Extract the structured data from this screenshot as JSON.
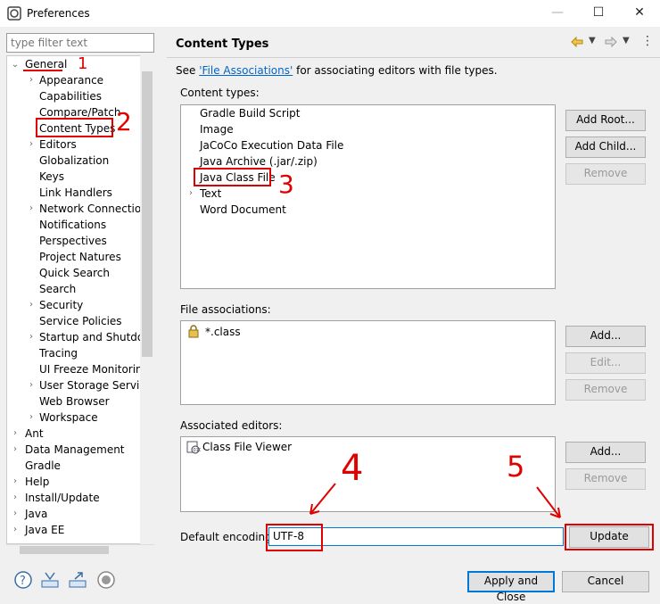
{
  "window": {
    "title": "Preferences",
    "minimize": "—",
    "maximize": "☐",
    "close": "✕"
  },
  "filter": {
    "placeholder": "type filter text"
  },
  "tree": {
    "general": "General",
    "general_children": [
      {
        "label": "Appearance",
        "expandable": true
      },
      {
        "label": "Capabilities",
        "expandable": false
      },
      {
        "label": "Compare/Patch",
        "expandable": false
      },
      {
        "label": "Content Types",
        "expandable": false
      },
      {
        "label": "Editors",
        "expandable": true
      },
      {
        "label": "Globalization",
        "expandable": false
      },
      {
        "label": "Keys",
        "expandable": false
      },
      {
        "label": "Link Handlers",
        "expandable": false
      },
      {
        "label": "Network Connection",
        "expandable": true
      },
      {
        "label": "Notifications",
        "expandable": false
      },
      {
        "label": "Perspectives",
        "expandable": false
      },
      {
        "label": "Project Natures",
        "expandable": false
      },
      {
        "label": "Quick Search",
        "expandable": false
      },
      {
        "label": "Search",
        "expandable": false
      },
      {
        "label": "Security",
        "expandable": true
      },
      {
        "label": "Service Policies",
        "expandable": false
      },
      {
        "label": "Startup and Shutdow",
        "expandable": true
      },
      {
        "label": "Tracing",
        "expandable": false
      },
      {
        "label": "UI Freeze Monitoring",
        "expandable": false
      },
      {
        "label": "User Storage Service",
        "expandable": true
      },
      {
        "label": "Web Browser",
        "expandable": false
      },
      {
        "label": "Workspace",
        "expandable": true
      }
    ],
    "top_level": [
      {
        "label": "Ant",
        "expandable": true
      },
      {
        "label": "Data Management",
        "expandable": true
      },
      {
        "label": "Gradle",
        "expandable": false
      },
      {
        "label": "Help",
        "expandable": true
      },
      {
        "label": "Install/Update",
        "expandable": true
      },
      {
        "label": "Java",
        "expandable": true
      },
      {
        "label": "Java EE",
        "expandable": true
      }
    ]
  },
  "page": {
    "title": "Content Types",
    "intro_before": "See ",
    "intro_link": "'File Associations'",
    "intro_after": " for associating editors with file types.",
    "content_types_label": "Content types:",
    "content_types": [
      {
        "label": "Gradle Build Script",
        "expandable": false
      },
      {
        "label": "Image",
        "expandable": false
      },
      {
        "label": "JaCoCo Execution Data File",
        "expandable": false
      },
      {
        "label": "Java Archive (.jar/.zip)",
        "expandable": false
      },
      {
        "label": "Java Class File",
        "expandable": false
      },
      {
        "label": "Text",
        "expandable": true
      },
      {
        "label": "Word Document",
        "expandable": false
      }
    ],
    "add_root": "Add Root...",
    "add_child": "Add Child...",
    "remove": "Remove",
    "file_assoc_label": "File associations:",
    "file_assoc": [
      "*.class"
    ],
    "add": "Add...",
    "edit": "Edit...",
    "assoc_editors_label": "Associated editors:",
    "assoc_editors": [
      "Class File Viewer"
    ],
    "default_encoding_label": "Default encoding:",
    "default_encoding_value": "UTF-8",
    "update": "Update"
  },
  "footer": {
    "apply_close": "Apply and Close",
    "cancel": "Cancel"
  },
  "annotations": [
    "1",
    "2",
    "3",
    "4",
    "5"
  ],
  "colors": {
    "accent": "#0066cc",
    "annotation": "#e00000"
  }
}
